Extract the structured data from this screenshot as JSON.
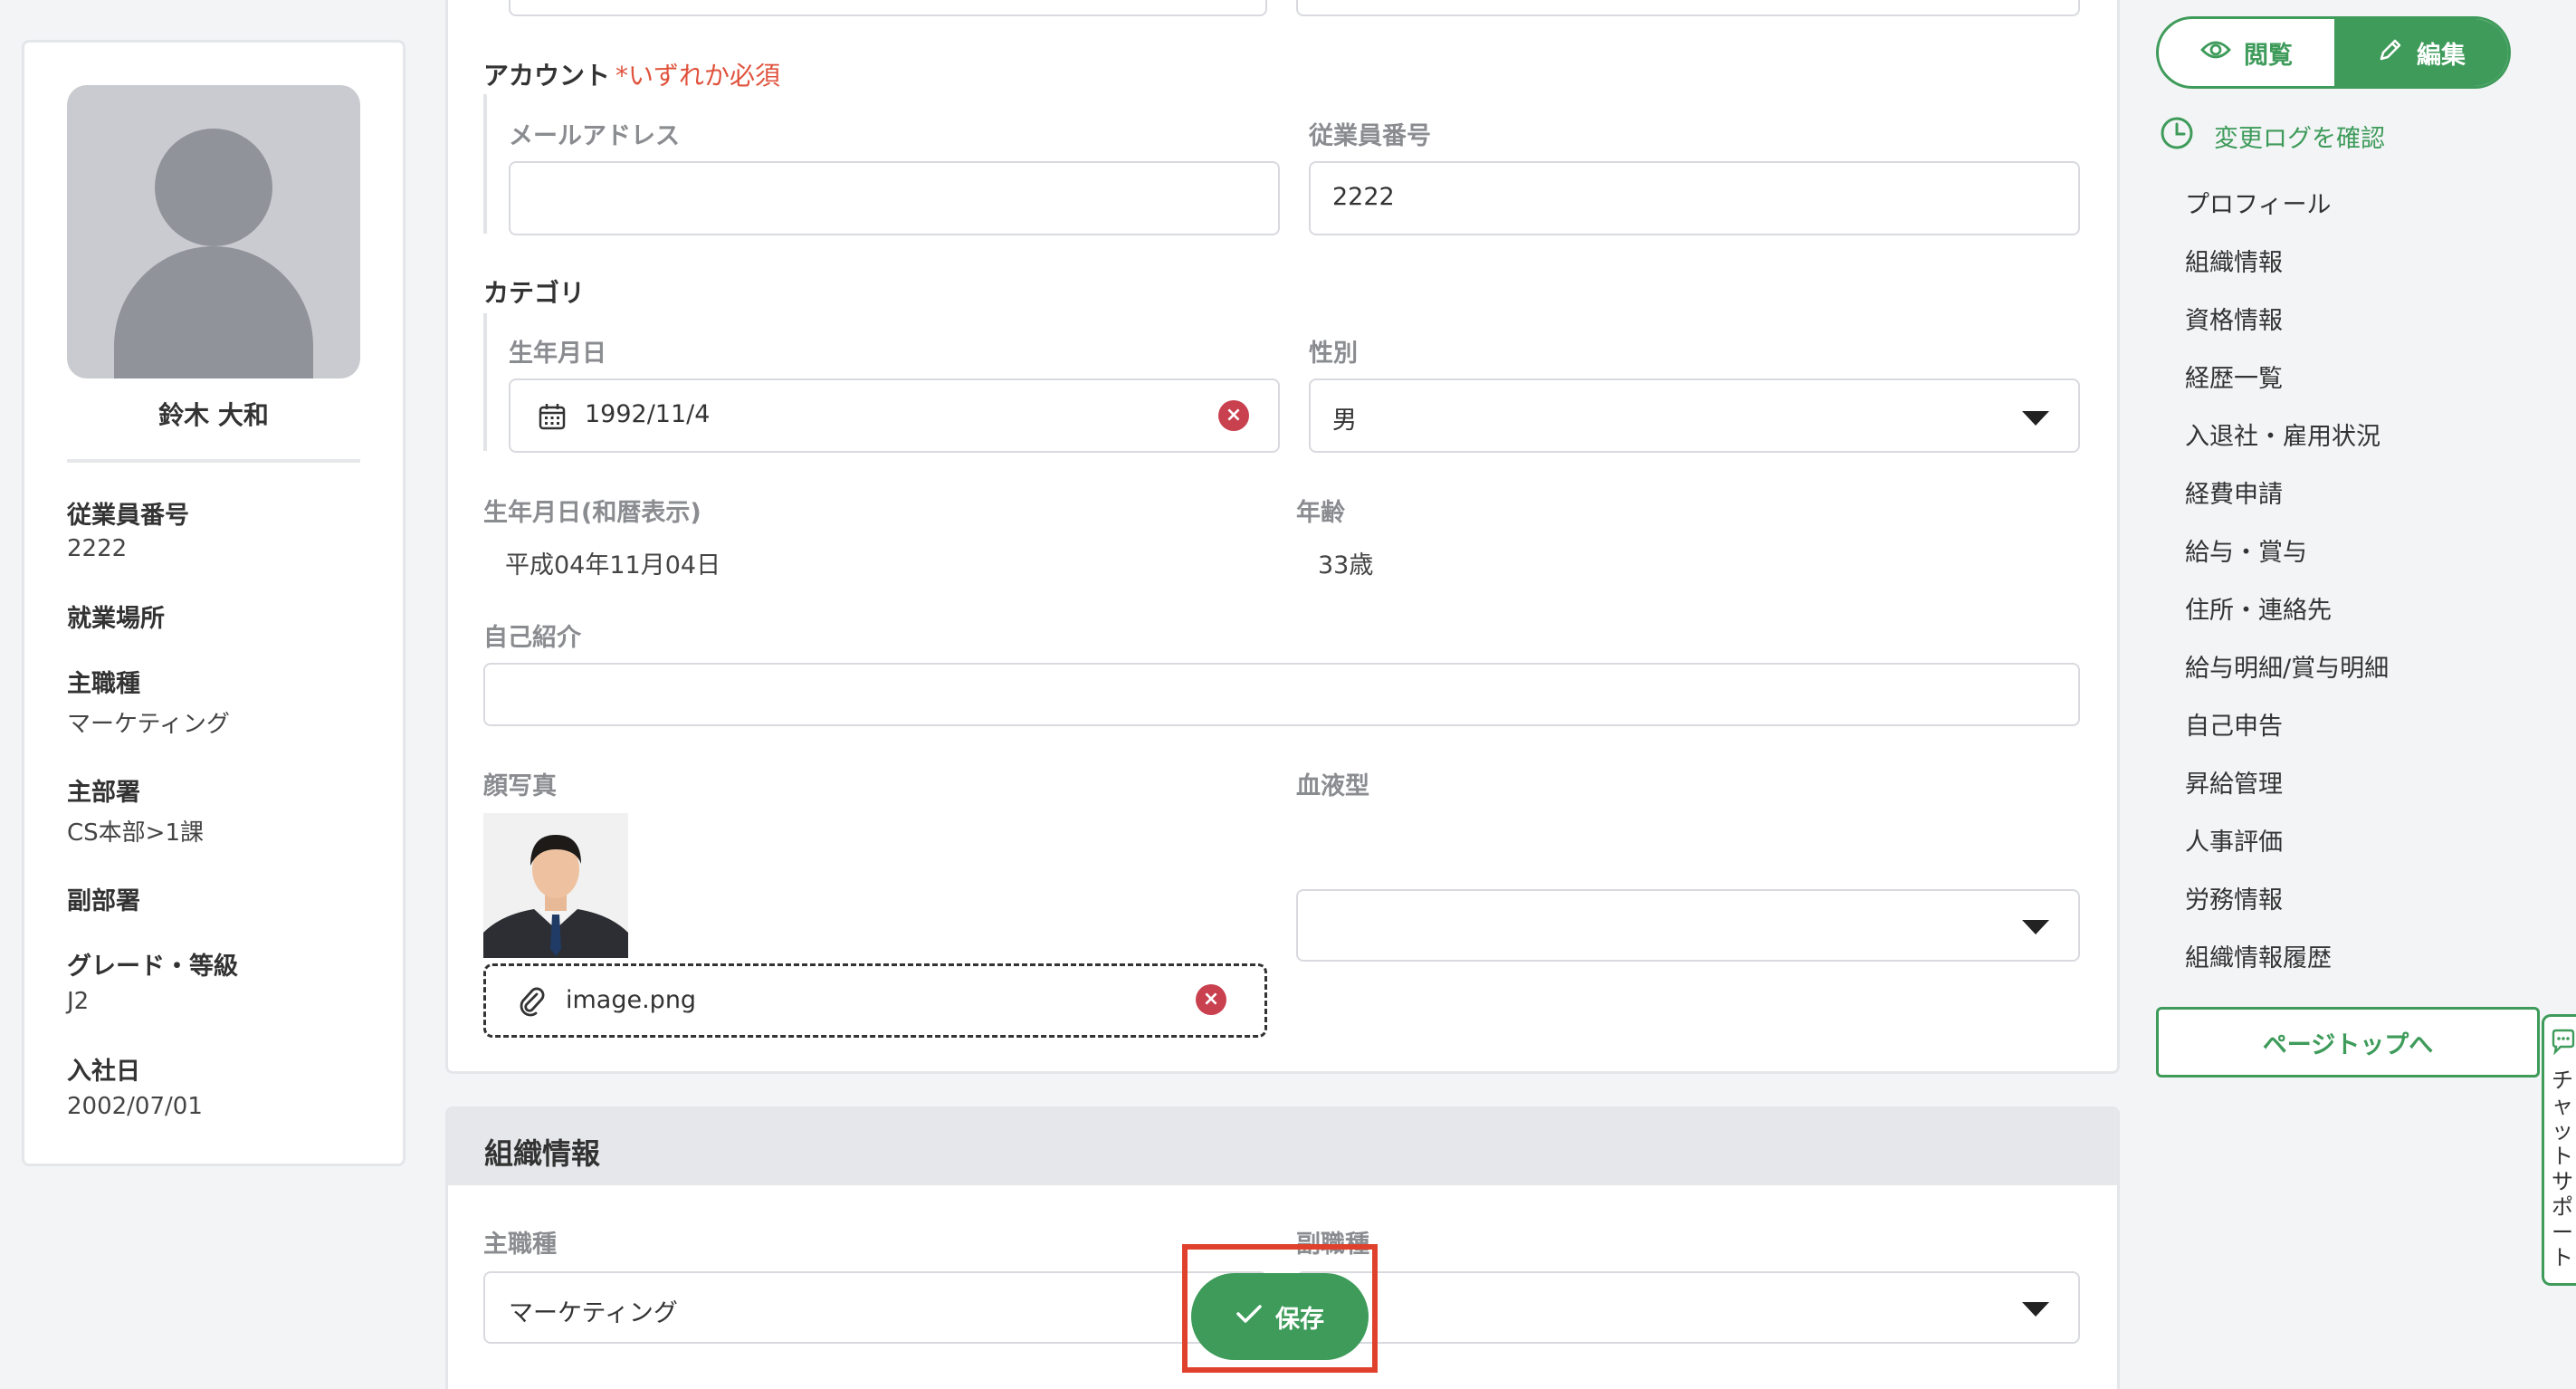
{
  "profile": {
    "name": "鈴木 大和",
    "fields": [
      {
        "label": "従業員番号",
        "value": "2222"
      },
      {
        "label": "就業場所",
        "value": ""
      },
      {
        "label": "主職種",
        "value": "マーケティング"
      },
      {
        "label": "主部署",
        "value": "CS本部>1課"
      },
      {
        "label": "副部署",
        "value": ""
      },
      {
        "label": "グレード・等級",
        "value": "J2"
      },
      {
        "label": "入社日",
        "value": "2002/07/01"
      }
    ]
  },
  "form": {
    "account": {
      "label": "アカウント",
      "required_note": "*いずれか必須"
    },
    "email": {
      "label": "メールアドレス",
      "value": ""
    },
    "employee_number": {
      "label": "従業員番号",
      "value": "2222"
    },
    "category": {
      "label": "カテゴリ"
    },
    "birthdate": {
      "label": "生年月日",
      "value": "1992/11/4"
    },
    "gender": {
      "label": "性別",
      "value": "男"
    },
    "birthdate_wareki": {
      "label": "生年月日(和暦表示)",
      "value": "平成04年11月04日"
    },
    "age": {
      "label": "年齢",
      "value": "33歳"
    },
    "self_intro": {
      "label": "自己紹介",
      "value": ""
    },
    "photo": {
      "label": "顔写真",
      "filename": "image.png"
    },
    "blood_type": {
      "label": "血液型",
      "value": ""
    }
  },
  "org_section": {
    "title": "組織情報",
    "main_job": {
      "label": "主職種",
      "value": "マーケティング"
    },
    "sub_job": {
      "label": "副職種",
      "value": ""
    }
  },
  "save_button": {
    "label": "保存"
  },
  "sidebar": {
    "view_label": "閲覧",
    "edit_label": "編集",
    "changelog_label": "変更ログを確認",
    "nav_items": [
      "プロフィール",
      "組織情報",
      "資格情報",
      "経歴一覧",
      "入退社・雇用状況",
      "経費申請",
      "給与・賞与",
      "住所・連絡先",
      "給与明細/賞与明細",
      "自己申告",
      "昇給管理",
      "人事評価",
      "労務情報",
      "組織情報履歴"
    ],
    "page_top_label": "ページトップへ",
    "chat_support_label": "チャットサポート"
  },
  "colors": {
    "accent": "#3e9b5a",
    "required": "#e0533d",
    "highlight": "#e0412c",
    "clear": "#c9404f"
  }
}
